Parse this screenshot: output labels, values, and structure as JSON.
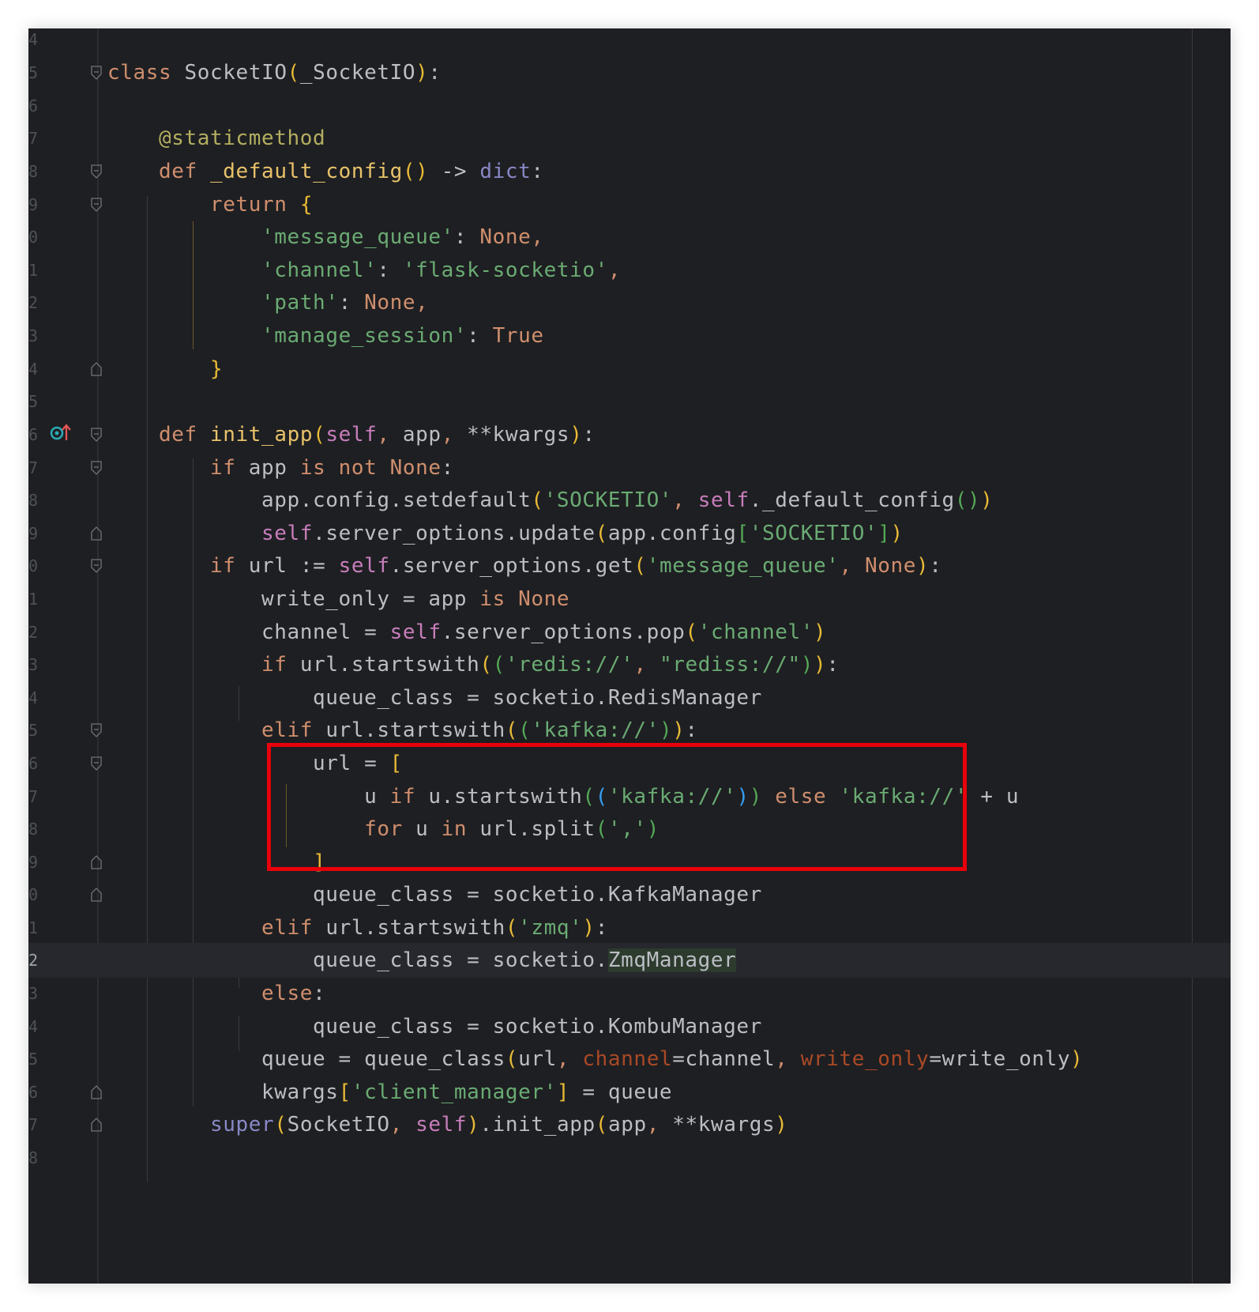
{
  "editor": {
    "language": "python",
    "accent_highlight_color": "#e8000b",
    "lines": [
      {
        "num": "4",
        "text": ""
      },
      {
        "num": "5",
        "text": "class SocketIO(_SocketIO):"
      },
      {
        "num": "6",
        "text": ""
      },
      {
        "num": "7",
        "text": "    @staticmethod"
      },
      {
        "num": "8",
        "text": "    def _default_config() -> dict:"
      },
      {
        "num": "9",
        "text": "        return {"
      },
      {
        "num": "0",
        "text": "            'message_queue': None,"
      },
      {
        "num": "1",
        "text": "            'channel': 'flask-socketio',"
      },
      {
        "num": "2",
        "text": "            'path': None,"
      },
      {
        "num": "3",
        "text": "            'manage_session': True"
      },
      {
        "num": "4",
        "text": "        }"
      },
      {
        "num": "5",
        "text": ""
      },
      {
        "num": "6",
        "text": "    def init_app(self, app, **kwargs):"
      },
      {
        "num": "7",
        "text": "        if app is not None:"
      },
      {
        "num": "8",
        "text": "            app.config.setdefault('SOCKETIO', self._default_config())"
      },
      {
        "num": "9",
        "text": "            self.server_options.update(app.config['SOCKETIO'])"
      },
      {
        "num": "0",
        "text": "        if url := self.server_options.get('message_queue', None):"
      },
      {
        "num": "1",
        "text": "            write_only = app is None"
      },
      {
        "num": "2",
        "text": "            channel = self.server_options.pop('channel')"
      },
      {
        "num": "3",
        "text": "            if url.startswith(('redis://', \"rediss://\")):"
      },
      {
        "num": "4",
        "text": "                queue_class = socketio.RedisManager"
      },
      {
        "num": "5",
        "text": "            elif url.startswith(('kafka://')):"
      },
      {
        "num": "6",
        "text": "                url = ["
      },
      {
        "num": "7",
        "text": "                    u if u.startswith(('kafka://')) else 'kafka://' + u"
      },
      {
        "num": "8",
        "text": "                    for u in url.split(',')"
      },
      {
        "num": "9",
        "text": "                ]"
      },
      {
        "num": "0",
        "text": "                queue_class = socketio.KafkaManager"
      },
      {
        "num": "1",
        "text": "            elif url.startswith('zmq'):"
      },
      {
        "num": "2",
        "text": "                queue_class = socketio.ZmqManager"
      },
      {
        "num": "3",
        "text": "            else:"
      },
      {
        "num": "4",
        "text": "                queue_class = socketio.KombuManager"
      },
      {
        "num": "5",
        "text": "            queue = queue_class(url, channel=channel, write_only=write_only)"
      },
      {
        "num": "6",
        "text": "            kwargs['client_manager'] = queue"
      },
      {
        "num": "7",
        "text": "        super(SocketIO, self).init_app(app, **kwargs)"
      },
      {
        "num": "8",
        "text": ""
      }
    ],
    "current_line_index": 28,
    "highlight_box_lines": [
      22,
      25
    ],
    "gutter_icon": "override-up-arrow-icon"
  }
}
